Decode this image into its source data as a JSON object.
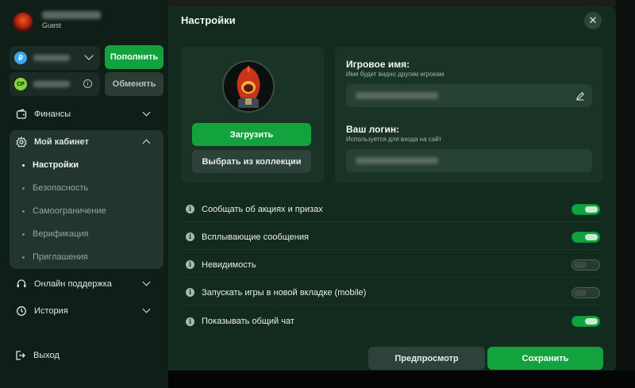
{
  "sidebar": {
    "user_status": "Guest",
    "topup_label": "Пополнить",
    "exchange_label": "Обменять",
    "wallets": [
      {
        "currency_icon": "ruble-icon",
        "symbol": "₽"
      },
      {
        "currency_icon": "cp-coin-icon",
        "symbol": "CP"
      }
    ],
    "nav": {
      "finance": "Финансы",
      "cabinet": "Мой кабинет",
      "support": "Онлайн поддержка",
      "history": "История",
      "logout": "Выход"
    },
    "cabinet_items": [
      {
        "label": "Настройки",
        "active": true
      },
      {
        "label": "Безопасность",
        "active": false
      },
      {
        "label": "Самоограничение",
        "active": false
      },
      {
        "label": "Верификация",
        "active": false
      },
      {
        "label": "Приглашения",
        "active": false
      }
    ]
  },
  "modal": {
    "title": "Настройки",
    "upload_label": "Загрузить",
    "collection_label": "Выбрать из коллекции",
    "game_name_label": "Игровое имя:",
    "game_name_hint": "Имя будет видно другим игрокам",
    "login_label": "Ваш логин:",
    "login_hint": "Используется для входа на сайт",
    "toggles": [
      {
        "label": "Сообщать об акциях и призах",
        "on": true
      },
      {
        "label": "Всплывающие сообщения",
        "on": true
      },
      {
        "label": "Невидимость",
        "on": false
      },
      {
        "label": "Запускать игры в новой вкладке (mobile)",
        "on": false
      },
      {
        "label": "Показывать общий чат",
        "on": true
      }
    ],
    "preview_label": "Предпросмотр",
    "save_label": "Сохранить"
  },
  "colors": {
    "accent": "#12a33e",
    "panel": "#132a1e",
    "sidebar": "#0f1f17"
  }
}
